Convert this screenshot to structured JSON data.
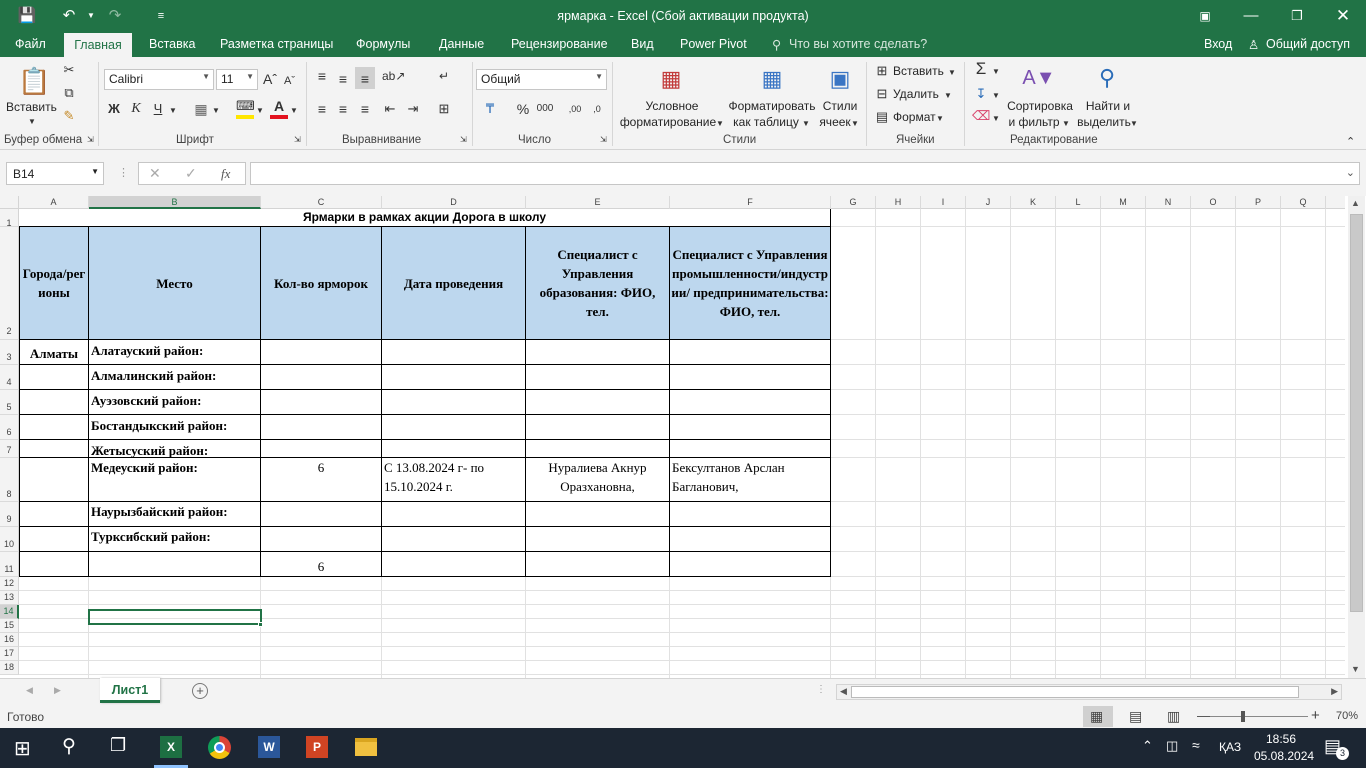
{
  "window": {
    "title": "ярмарка - Excel (Сбой активации продукта)"
  },
  "ribbon_tabs": [
    "Файл",
    "Главная",
    "Вставка",
    "Разметка страницы",
    "Формулы",
    "Данные",
    "Рецензирование",
    "Вид",
    "Power Pivot"
  ],
  "tell_me": "Что вы хотите сделать?",
  "signin": "Вход",
  "share": "Общий доступ",
  "ribbon": {
    "clipboard": {
      "paste": "Вставить",
      "label": "Буфер обмена"
    },
    "font": {
      "name": "Calibri",
      "size": "11",
      "label": "Шрифт",
      "bold": "Ж",
      "italic": "К",
      "underline": "Ч"
    },
    "alignment": {
      "label": "Выравнивание"
    },
    "number": {
      "format": "Общий",
      "label": "Число"
    },
    "styles": {
      "cond1": "Условное",
      "cond2": "форматирование",
      "fmt1": "Форматировать",
      "fmt2": "как таблицу",
      "cell1": "Стили",
      "cell2": "ячеек",
      "label": "Стили"
    },
    "cells": {
      "insert": "Вставить",
      "delete": "Удалить",
      "format": "Формат",
      "label": "Ячейки"
    },
    "editing": {
      "sort1": "Сортировка",
      "sort2": "и фильтр",
      "find1": "Найти и",
      "find2": "выделить",
      "label": "Редактирование"
    }
  },
  "formula_bar": {
    "name_box": "B14",
    "fx": "fx",
    "content": ""
  },
  "columns": [
    "A",
    "B",
    "C",
    "D",
    "E",
    "F",
    "G",
    "H",
    "I",
    "J",
    "K",
    "L",
    "M",
    "N",
    "O",
    "P",
    "Q"
  ],
  "rows": [
    "1",
    "2",
    "3",
    "4",
    "5",
    "6",
    "7",
    "8",
    "9",
    "10",
    "11",
    "12",
    "13",
    "14",
    "15",
    "16",
    "17",
    "18"
  ],
  "sheet": {
    "title": "Ярмарки в рамках акции Дорога в школу",
    "headers": [
      "Города/регионы",
      "Место",
      "Кол-во ярморок",
      "Дата проведения",
      "Специалист с Управления образования: ФИО, тел.",
      "Специалист с Управления промышленности/индустрии/ предпринимательства: ФИО, тел."
    ],
    "city": "Алматы",
    "districts": [
      "Алатауский район:",
      "Алмалинский район:",
      "Ауэзовский район:",
      "Бостандыкский район:",
      "Жетысуский район:",
      "Медеуский район:",
      "Наурызбайский район:",
      "Турксибский район:"
    ],
    "medeu": {
      "count": "6",
      "date": "С 13.08.2024 г- по 15.10.2024 г.",
      "edu": "Нуралиева Акнур Оразхановна,",
      "ind": "Бексултанов Арслан Багланович,"
    },
    "total": "6"
  },
  "sheet_tab": "Лист1",
  "status": {
    "ready": "Готово",
    "zoom": "70%"
  },
  "taskbar": {
    "lang": "ҚАЗ",
    "time": "18:56",
    "date": "05.08.2024",
    "notif": "3"
  }
}
